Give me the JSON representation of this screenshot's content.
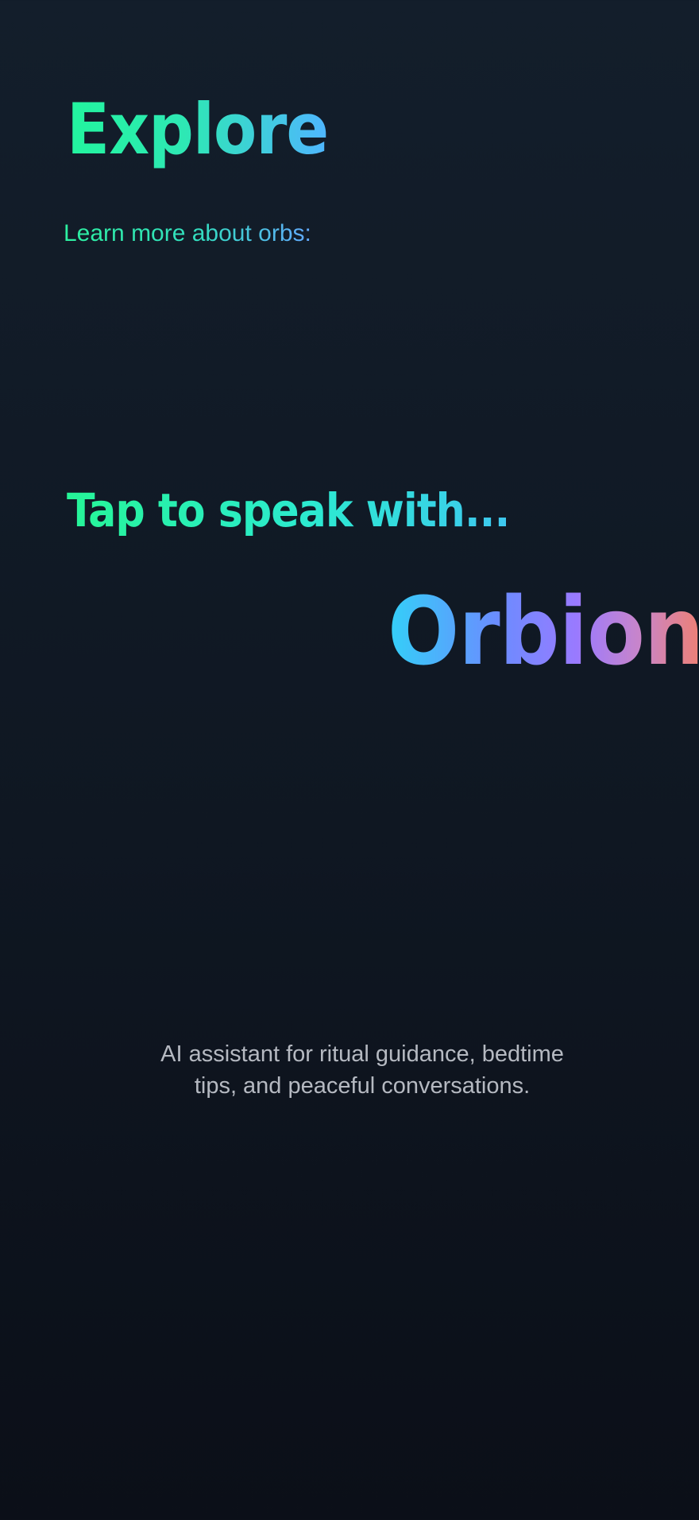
{
  "header": {
    "title": "Explore",
    "subtitle": "Learn more about orbs:"
  },
  "main": {
    "prompt": "Tap to speak with...",
    "orb_name": "Orbion",
    "orb_description": "AI assistant for ritual guidance, bedtime tips, and peaceful conversations."
  },
  "colors": {
    "background_top": "#131e2b",
    "background_bottom": "#0b0f18",
    "accent_green": "#22f59e",
    "accent_blue": "#4fb6ff",
    "accent_purple": "#9a7aff",
    "accent_coral": "#f08070",
    "description_text": "#b5b9c1"
  }
}
